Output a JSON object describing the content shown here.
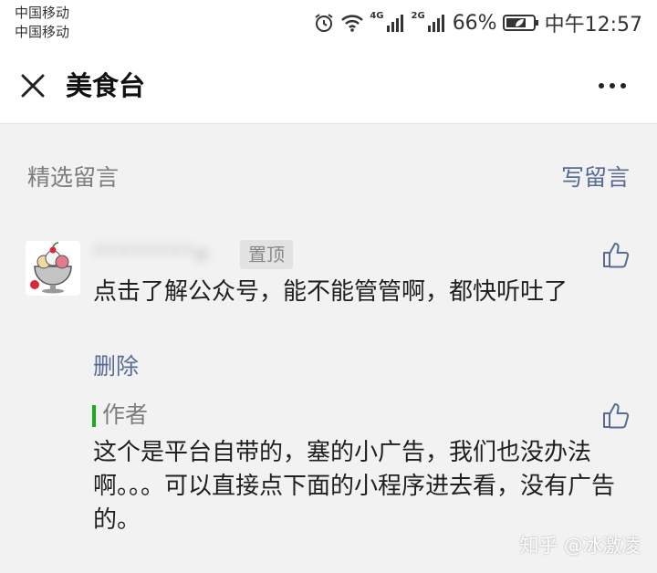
{
  "status_bar": {
    "carrier_1": "中国移动",
    "carrier_2": "中国移动",
    "net_1": "4G",
    "net_2": "2G",
    "battery": "66%",
    "time": "中午12:57",
    "icons": [
      "alarm-icon",
      "wifi-icon",
      "signal-icon",
      "battery-icon"
    ]
  },
  "header": {
    "title": "美食台",
    "close_icon": "close-icon",
    "more_icon": "more-icon"
  },
  "section": {
    "title": "精选留言",
    "write_label": "写留言"
  },
  "comment": {
    "username": "********e",
    "pin_label": "置顶",
    "text": "点击了解公众号，能不能管管啊，都快听吐了",
    "delete_label": "删除",
    "like_icon": "thumbs-up-icon"
  },
  "reply": {
    "author_label": "作者",
    "text": "这个是平台自带的，塞的小广告，我们也没办法啊。。。可以直接点下面的小程序进去看，没有广告的。",
    "like_icon": "thumbs-up-icon"
  },
  "watermark": "知乎 @冰激凌",
  "colors": {
    "link": "#576b95",
    "author_accent": "#1aad19",
    "background": "#f2f2f2",
    "muted_text": "#7d7d7d"
  }
}
